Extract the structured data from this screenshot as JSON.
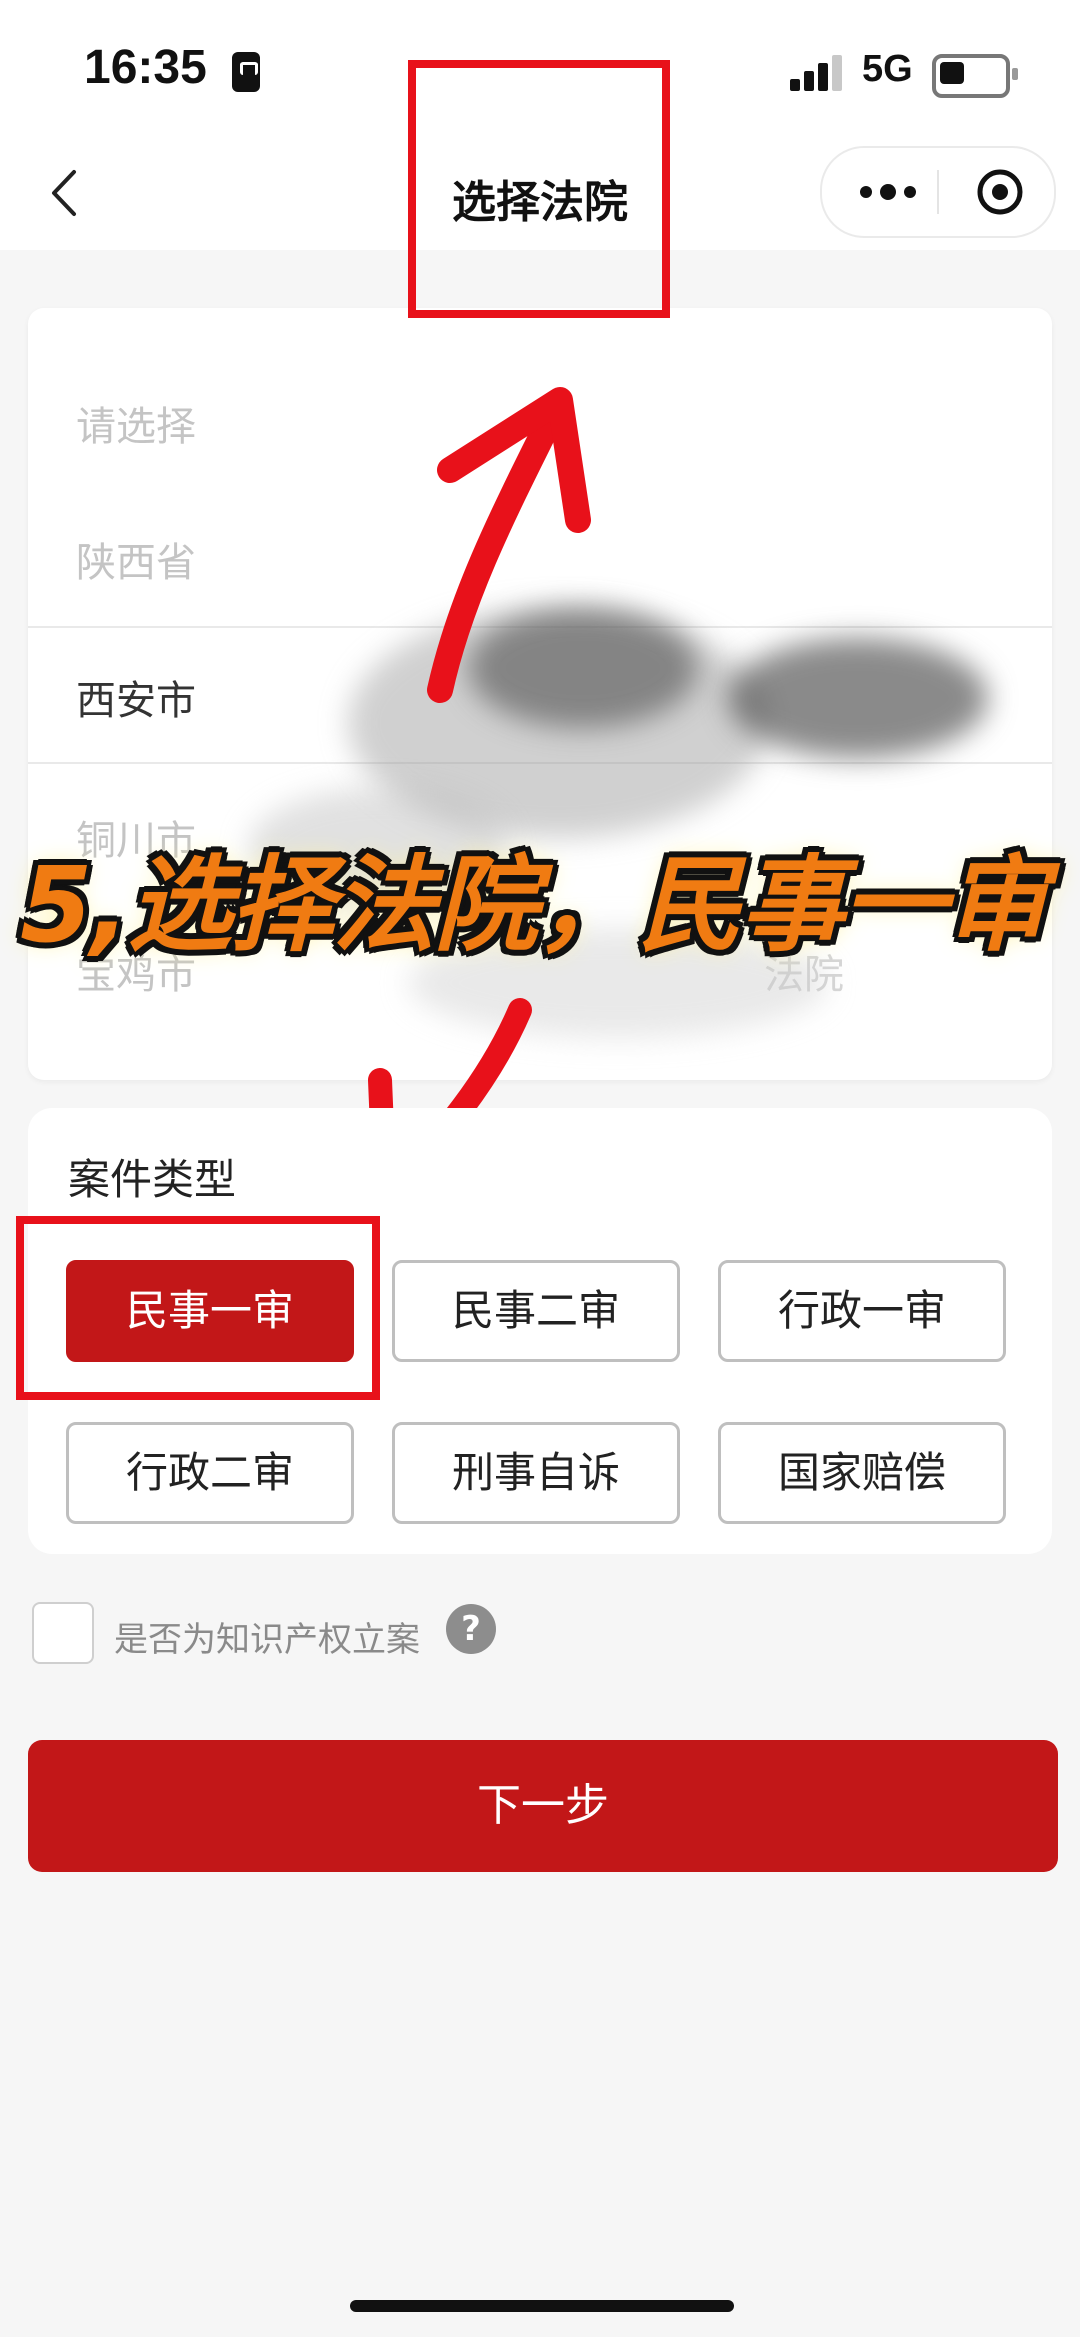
{
  "status_bar": {
    "time": "16:35",
    "network": "5G"
  },
  "nav": {
    "title": "选择法院"
  },
  "picker": {
    "items": [
      {
        "label": "请选择",
        "active": false
      },
      {
        "label": "陕西省",
        "active": false
      },
      {
        "label": "西安市",
        "active": true
      },
      {
        "label": "铜川市",
        "active": false
      },
      {
        "label": "宝鸡市",
        "active": false
      }
    ],
    "partial_right_text": "法院"
  },
  "annotation": {
    "banner_text": "5,选择法院，民事一审"
  },
  "case_type": {
    "title": "案件类型",
    "options": [
      {
        "label": "民事一审",
        "selected": true
      },
      {
        "label": "民事二审",
        "selected": false
      },
      {
        "label": "行政一审",
        "selected": false
      },
      {
        "label": "行政二审",
        "selected": false
      },
      {
        "label": "刑事自诉",
        "selected": false
      },
      {
        "label": "国家赔偿",
        "selected": false
      }
    ]
  },
  "ip_option": {
    "label": "是否为知识产权立案",
    "help": "?"
  },
  "next_button": {
    "label": "下一步"
  },
  "colors": {
    "primary": "#c21718",
    "annotation_red": "#e8111a",
    "banner_orange": "#f07b12"
  }
}
